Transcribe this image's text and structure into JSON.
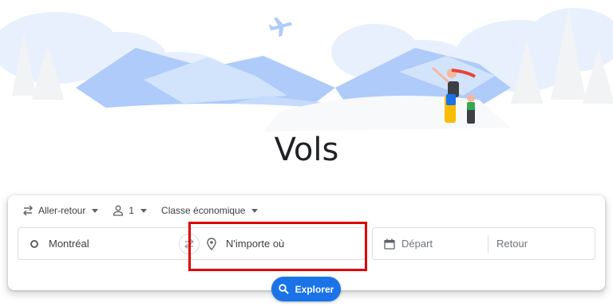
{
  "page": {
    "title": "Vols"
  },
  "options": {
    "trip_type": "Aller-retour",
    "passengers": "1",
    "cabin_class": "Classe économique"
  },
  "search": {
    "origin_value": "Montréal",
    "destination_placeholder": "N'importe où",
    "departure_placeholder": "Départ",
    "return_placeholder": "Retour"
  },
  "actions": {
    "explore_label": "Explorer"
  },
  "colors": {
    "accent": "#1a73e8",
    "highlight": "#e00000",
    "hero_blue": "#aecbfa"
  }
}
